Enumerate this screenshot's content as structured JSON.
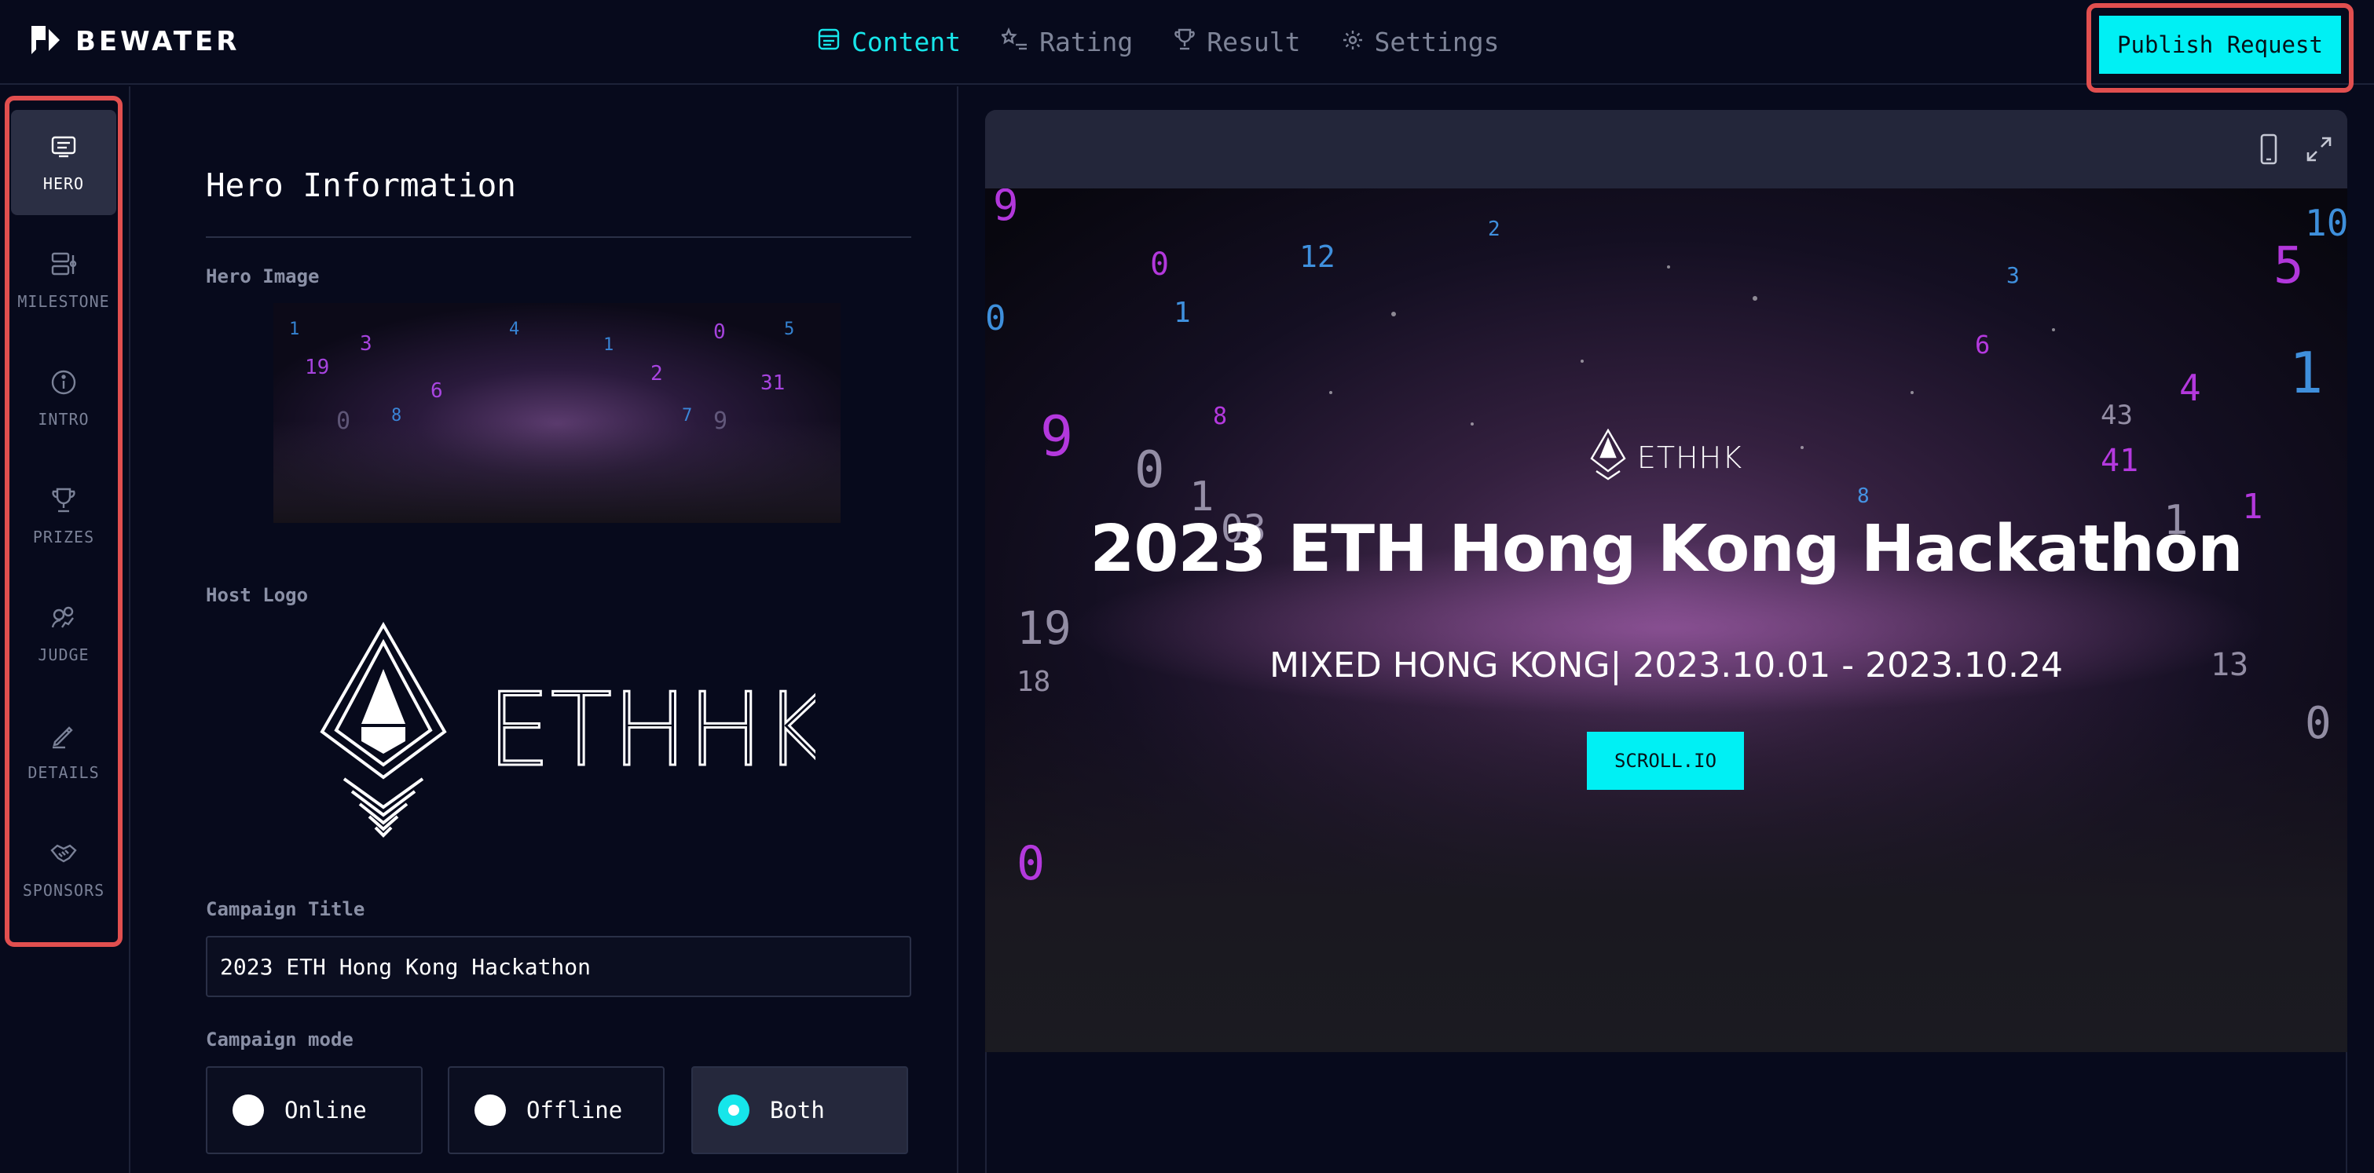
{
  "app": {
    "brand": "BEWATER"
  },
  "topnav": {
    "tabs": [
      {
        "label": "Content",
        "icon": "content-icon",
        "active": true
      },
      {
        "label": "Rating",
        "icon": "rating-icon",
        "active": false
      },
      {
        "label": "Result",
        "icon": "trophy-icon",
        "active": false
      },
      {
        "label": "Settings",
        "icon": "gear-icon",
        "active": false
      }
    ],
    "publish_label": "Publish Request"
  },
  "sidebar": {
    "items": [
      {
        "label": "HERO",
        "icon": "hero-icon",
        "active": true
      },
      {
        "label": "MILESTONE",
        "icon": "milestone-icon",
        "active": false
      },
      {
        "label": "INTRO",
        "icon": "info-icon",
        "active": false
      },
      {
        "label": "PRIZES",
        "icon": "trophy-icon",
        "active": false
      },
      {
        "label": "JUDGE",
        "icon": "judge-icon",
        "active": false
      },
      {
        "label": "DETAILS",
        "icon": "pencil-icon",
        "active": false
      },
      {
        "label": "SPONSORS",
        "icon": "handshake-icon",
        "active": false
      }
    ]
  },
  "editor": {
    "section_title": "Hero Information",
    "hero_image_label": "Hero Image",
    "host_logo_label": "Host Logo",
    "host_logo_text": "ETHHK",
    "campaign_title_label": "Campaign Title",
    "campaign_title_value": "2023 ETH Hong Kong Hackathon",
    "campaign_mode_label": "Campaign mode",
    "modes": [
      {
        "label": "Online",
        "selected": false
      },
      {
        "label": "Offline",
        "selected": false
      },
      {
        "label": "Both",
        "selected": true
      }
    ]
  },
  "preview": {
    "logo_text": "ETHHK",
    "title": "2023 ETH Hong Kong Hackathon",
    "subtitle": "MIXED HONG KONG| 2023.10.01 - 2023.10.24",
    "cta_label": "SCROLL.IO"
  },
  "colors": {
    "accent": "#00f0f4",
    "highlight": "#e14f4f",
    "background": "#070a1c"
  }
}
